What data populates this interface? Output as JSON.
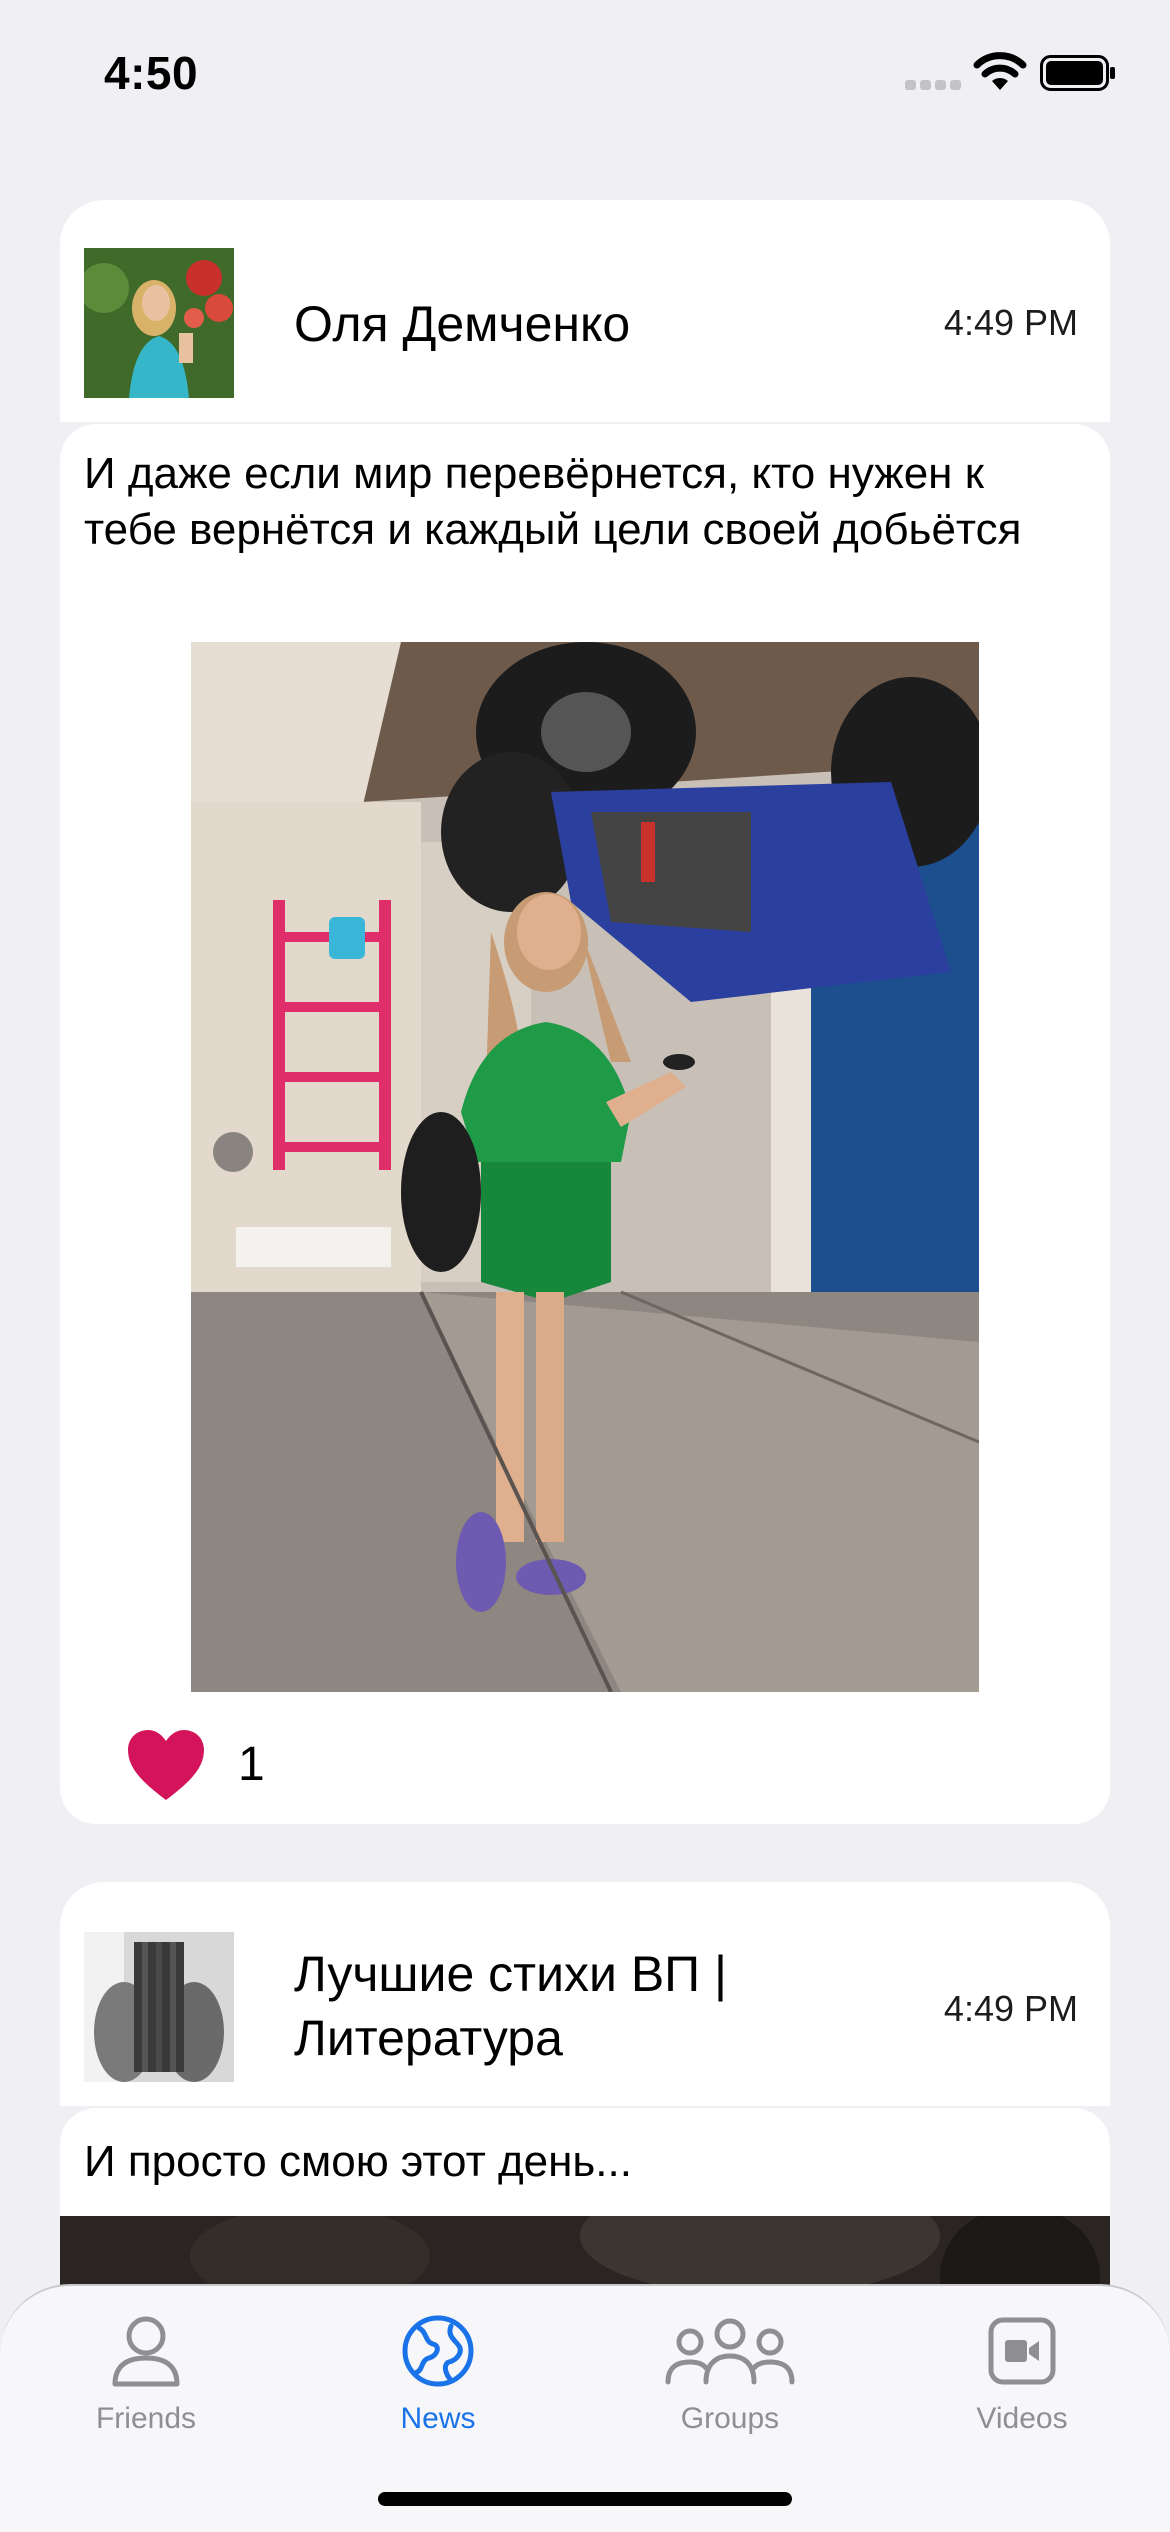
{
  "status_bar": {
    "time": "4:50"
  },
  "posts": [
    {
      "author": "Оля Демченко",
      "time": "4:49 PM",
      "text": "И даже если мир перевёрнется, кто нужен к тебе вернётся и каждый цели своей добьётся",
      "likes": "1"
    },
    {
      "author": "Лучшие стихи ВП | Литература",
      "time": "4:49 PM",
      "text": "И просто смою этот день..."
    }
  ],
  "tabs": [
    {
      "label": "Friends",
      "icon": "person-icon",
      "active": false
    },
    {
      "label": "News",
      "icon": "globe-icon",
      "active": true
    },
    {
      "label": "Groups",
      "icon": "group-icon",
      "active": false
    },
    {
      "label": "Videos",
      "icon": "video-icon",
      "active": false
    }
  ],
  "colors": {
    "accent": "#1a73e8",
    "like": "#d4145a",
    "background": "#efeff4"
  }
}
